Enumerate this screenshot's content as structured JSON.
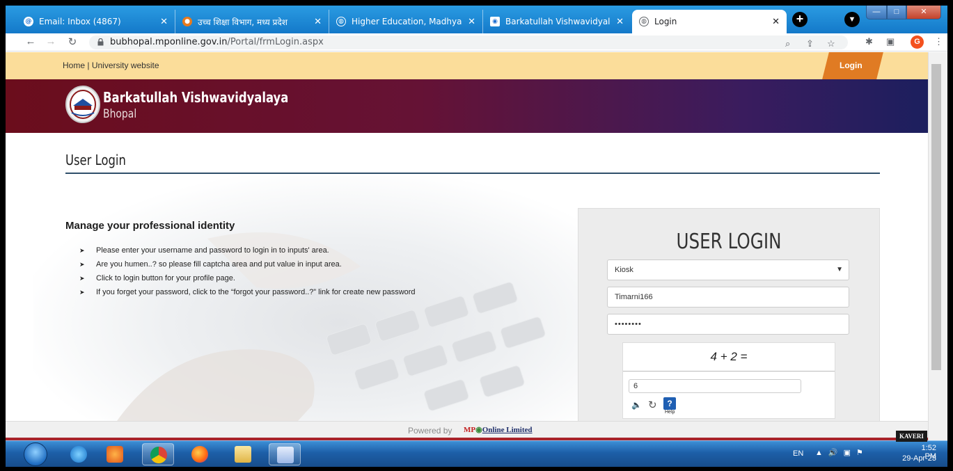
{
  "browser": {
    "tabs": [
      {
        "title": "Email: Inbox (4867)",
        "favicon": "email-icon",
        "color": "#1f6fd1"
      },
      {
        "title": "उच्च शिक्षा विभाग, मध्य प्रदेश",
        "favicon": "mp-govt-icon",
        "color": "#e87a1d"
      },
      {
        "title": "Higher Education, Madhya Pra",
        "favicon": "globe-icon",
        "color": "#ffffff"
      },
      {
        "title": "Barkatullah Vishwavidyalaya,B",
        "favicon": "bu-icon",
        "color": "#ffffff"
      },
      {
        "title": "Login",
        "favicon": "globe-icon",
        "color": "#5f6368"
      }
    ],
    "new_tab": "+",
    "url_host": "bubhopal.mponline.gov.in",
    "url_path": "/Portal/frmLogin.aspx",
    "profile_initial": "G",
    "window_min": "—",
    "window_max": "□",
    "window_close": "✕"
  },
  "page": {
    "top_links": {
      "home": "Home",
      "separator": " | ",
      "university": "University website"
    },
    "login_tab": "Login",
    "university_name": "Barkatullah Vishwavidyalaya",
    "university_city": "Bhopal",
    "heading": "User Login",
    "manage_title": "Manage your professional identity",
    "bullets": [
      "Please enter your username and password to login in to inputs' area.",
      "Are you humen..? so please fill captcha area and put value in input area.",
      "Click to login button for your profile page.",
      "If you forget your password, click to the “forgot your password..?” link for create new password"
    ],
    "login_panel": {
      "title": "USER LOGIN",
      "user_type": "Kiosk",
      "username": "Timarni166",
      "password_mask": "••••••••",
      "captcha_equation": "4 + 2 =",
      "captcha_answer": "6",
      "help_label": "Help",
      "help_glyph": "?"
    },
    "footer": {
      "powered_by": "Powered by",
      "brand_mp": "MP",
      "brand_online": "Online Limited"
    }
  },
  "taskbar": {
    "language": "EN",
    "time": "1:52 PM",
    "date": "29-Apr-23",
    "tray_label": "KAVERI"
  },
  "colors": {
    "tab_strip": "#1a8fd8",
    "top_strip": "#fbdd9a",
    "login_accent": "#e07b23",
    "banner_start": "#6b0d1c",
    "banner_end": "#1c1f5e",
    "footer_red": "#a8232b"
  }
}
